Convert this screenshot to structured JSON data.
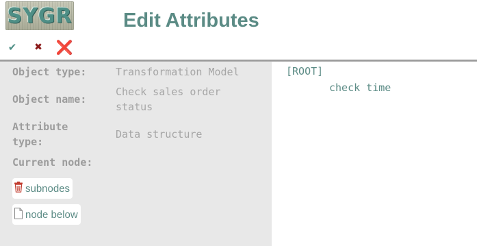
{
  "header": {
    "logo_text": "SYGR",
    "title": "Edit Attributes"
  },
  "toolbar": {
    "ok_icon": "✔",
    "cancel_icon": "✖",
    "delete_icon": "❌"
  },
  "details": {
    "object_type_label": "Object type:",
    "object_type_value": "Transformation Model",
    "object_name_label": "Object name:",
    "object_name_value": "Check sales order status",
    "attribute_type_label": "Attribute type:",
    "attribute_type_value": "Data structure",
    "current_node_label": "Current node:"
  },
  "actions": {
    "subnodes_label": "subnodes",
    "node_below_label": "node below"
  },
  "tree": {
    "root_label": "[ROOT]",
    "child_label": "check time"
  },
  "colors": {
    "accent": "#5b8b85",
    "left_panel_bg": "#e8e8e8",
    "label_gray": "#9c9c9c",
    "cancel_red": "#8b1a1a",
    "delete_red": "#e02020"
  }
}
